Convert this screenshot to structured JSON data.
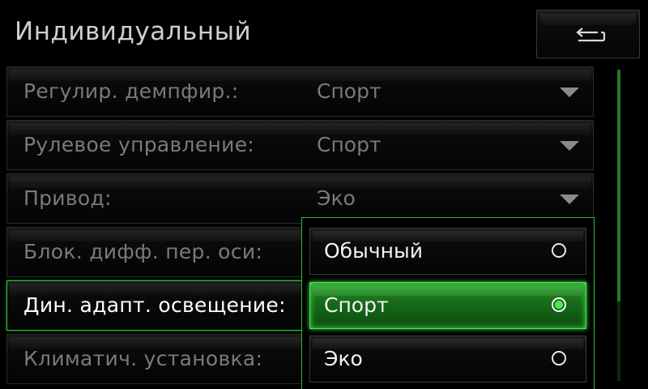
{
  "header": {
    "title": "Индивидуальный",
    "back_icon": "return-arrow-icon"
  },
  "settings": [
    {
      "label": "Регулир. демпфир.:",
      "value": "Спорт"
    },
    {
      "label": "Рулевое управление:",
      "value": "Спорт"
    },
    {
      "label": "Привод:",
      "value": "Эко"
    },
    {
      "label": "Блок. дифф. пер. оси:",
      "value": ""
    },
    {
      "label": "Дин. адапт. освещение:",
      "value": ""
    },
    {
      "label": "Климатич. установка:",
      "value": ""
    }
  ],
  "dropdown": {
    "options": [
      {
        "label": "Обычный",
        "selected": false
      },
      {
        "label": "Спорт",
        "selected": true
      },
      {
        "label": "Эко",
        "selected": false
      }
    ]
  },
  "colors": {
    "accent": "#35c23a",
    "background": "#000000",
    "text_dim": "#7a7a7a",
    "text_bright": "#ffffff"
  }
}
